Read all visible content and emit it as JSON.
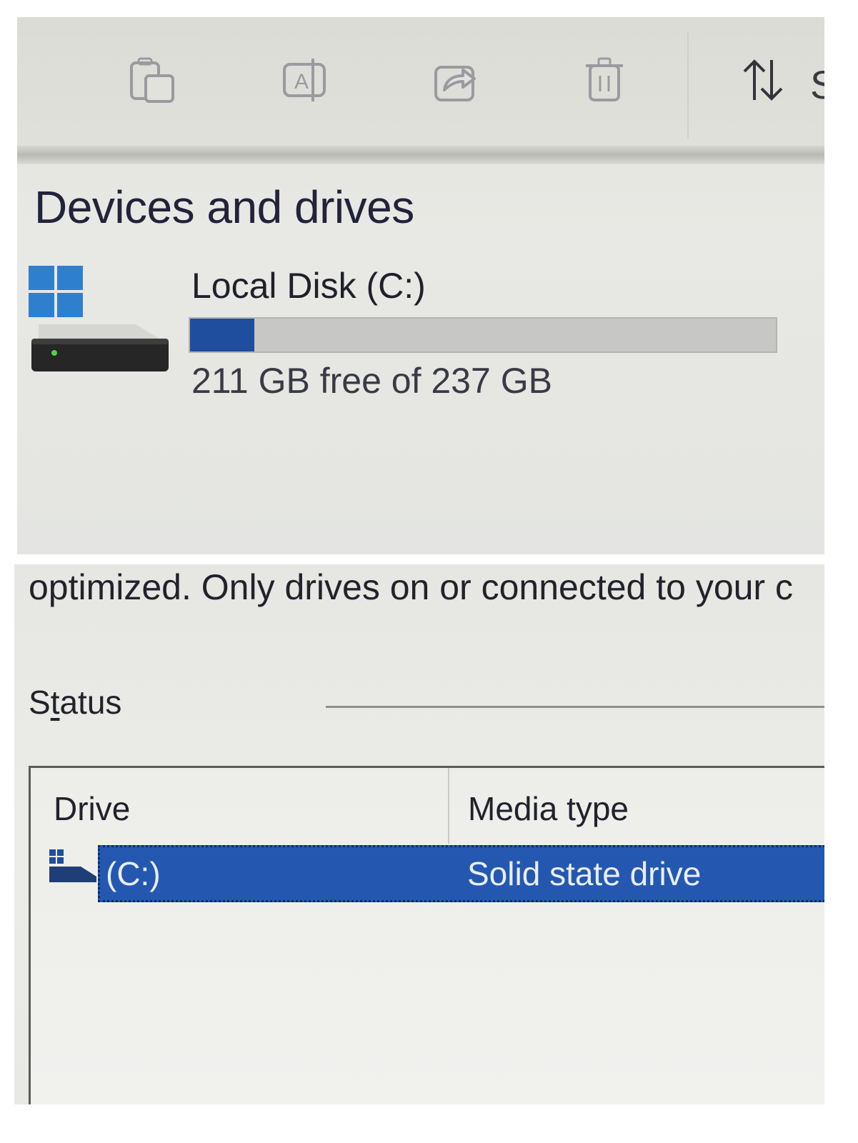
{
  "toolbar": {
    "buttons": [
      {
        "name": "copy",
        "icon": "copy-icon"
      },
      {
        "name": "rename",
        "icon": "rename-icon"
      },
      {
        "name": "share",
        "icon": "share-icon"
      },
      {
        "name": "delete",
        "icon": "trash-icon"
      },
      {
        "name": "sort",
        "icon": "sort-arrows-icon"
      }
    ],
    "clipped_label": "S"
  },
  "devices": {
    "section_title": "Devices and drives",
    "drives": [
      {
        "name": "Local Disk (C:)",
        "free_text": "211 GB free of 237 GB",
        "used_fraction": 0.11,
        "icon": "windows-drive-icon"
      }
    ]
  },
  "optimize": {
    "description": "optimized. Only drives on or connected to your c",
    "status_label_prefix": "S",
    "status_label_underlined": "t",
    "status_label_rest": "atus",
    "columns": {
      "drive": "Drive",
      "media_type": "Media type"
    },
    "rows": [
      {
        "drive": "(C:)",
        "media_type": "Solid state drive",
        "selected": true
      }
    ]
  },
  "colors": {
    "accent_blue": "#1f4e9e",
    "selection_blue": "#2458b0",
    "bar_track": "#c7c7c6"
  }
}
